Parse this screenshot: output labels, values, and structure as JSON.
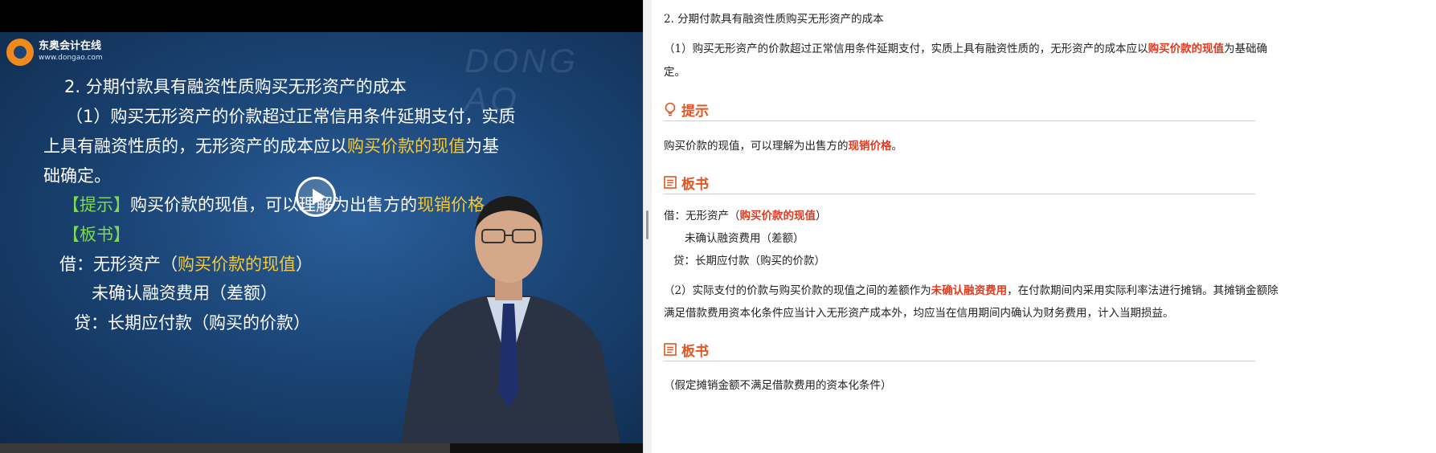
{
  "video": {
    "logo_name": "东奥会计在线",
    "logo_url": "www.dongao.com",
    "watermark": "DONG AO",
    "slide": {
      "title": "2. 分期付款具有融资性质购买无形资产的成本",
      "p1_line1": "（1）购买无形资产的价款超过正常信用条件延期支付，实质",
      "p1_line2_a": "上具有融资性质的，无形资产的成本应以",
      "p1_line2_b": "购买价款的现值",
      "p1_line2_c": "为基",
      "p1_line3": "础确定。",
      "tip_tag": "【提示】",
      "tip_a": "购买价款的现值，可以理解为出售方的",
      "tip_b": "现销价格",
      "board_tag": "【板书】",
      "debit_a": "借：无形资产（",
      "debit_b": "购买价款的现值",
      "debit_c": "）",
      "unrecognized": "未确认融资费用（差额）",
      "credit": "贷：长期应付款（购买的价款）"
    }
  },
  "notes": {
    "heading": "2. 分期付款具有融资性质购买无形资产的成本",
    "p1_a": "（1）购买无形资产的价款超过正常信用条件延期支付，实质上具有融资性质的，无形资产的成本应以",
    "p1_red": "购买价款的现值",
    "p1_b": "为基础确",
    "p1_c": "定。",
    "tip_title": "提示",
    "tip_a": "购买价款的现值，可以理解为出售方的",
    "tip_red": "现销价格",
    "tip_b": "。",
    "board1_title": "板书",
    "debit_a": "借：无形资产（",
    "debit_red": "购买价款的现值",
    "debit_b": "）",
    "unrecognized": "未确认融资费用（差额）",
    "credit": "贷：长期应付款（购买的价款）",
    "p2_a": "（2）实际支付的价款与购买价款的现值之间的差额作为",
    "p2_red": "未确认融资费用",
    "p2_b": "，在付款期间内采用实际利率法进行摊销。其摊销金额除",
    "p2_c": "满足借款费用资本化条件应当计入无形资产成本外，均应当在信用期间内确认为财务费用，计入当期损益。",
    "board2_title": "板书",
    "last_line": "（假定摊销金额不满足借款费用的资本化条件）"
  }
}
